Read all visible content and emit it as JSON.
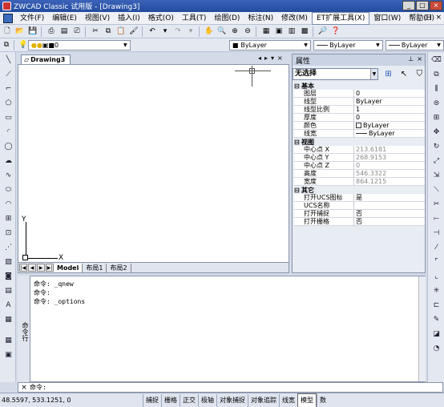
{
  "window": {
    "title": "ZWCAD Classic 试用版 - [Drawing3]"
  },
  "menu": [
    "文件(F)",
    "编辑(E)",
    "视图(V)",
    "插入(I)",
    "格式(O)",
    "工具(T)",
    "绘图(D)",
    "标注(N)",
    "修改(M)",
    "ET扩展工具(X)",
    "窗口(W)",
    "帮助(H)"
  ],
  "menu_active_index": 9,
  "toolbar2": {
    "layer_value": "0",
    "color_value": "ByLayer",
    "linetype_value": "ByLayer",
    "lineweight_value": "ByLayer"
  },
  "document": {
    "tab_label": "Drawing3",
    "axis_x": "X",
    "axis_y": "Y",
    "layout_tabs": [
      "Model",
      "布局1",
      "布局2"
    ]
  },
  "properties": {
    "header": "属性",
    "selection": "无选择",
    "categories": [
      {
        "name": "基本",
        "rows": [
          {
            "k": "图层",
            "v": "0",
            "dim": false
          },
          {
            "k": "线型",
            "v": "ByLayer",
            "dim": false
          },
          {
            "k": "线型比例",
            "v": "1",
            "dim": false
          },
          {
            "k": "厚度",
            "v": "0",
            "dim": false
          },
          {
            "k": "颜色",
            "v": "ByLayer",
            "dim": false,
            "marker": "swatch"
          },
          {
            "k": "线宽",
            "v": "ByLayer",
            "dim": false,
            "marker": "line"
          }
        ]
      },
      {
        "name": "视图",
        "rows": [
          {
            "k": "中心点 X",
            "v": "213.6181",
            "dim": true
          },
          {
            "k": "中心点 Y",
            "v": "268.9153",
            "dim": true
          },
          {
            "k": "中心点 Z",
            "v": "0",
            "dim": true
          },
          {
            "k": "高度",
            "v": "546.3322",
            "dim": true
          },
          {
            "k": "宽度",
            "v": "864.1215",
            "dim": true
          }
        ]
      },
      {
        "name": "其它",
        "rows": [
          {
            "k": "打开UCS图标",
            "v": "是",
            "dim": false
          },
          {
            "k": "UCS名称",
            "v": "",
            "dim": false
          },
          {
            "k": "打开捕捉",
            "v": "否",
            "dim": false
          },
          {
            "k": "打开栅格",
            "v": "否",
            "dim": false
          }
        ]
      }
    ]
  },
  "command": {
    "gutter": "命令行",
    "history": [
      "命令: _qnew",
      "命令:",
      "命令: _options"
    ],
    "prompt": "命令:"
  },
  "status": {
    "coords": "48.5597,  533.1251,  0",
    "buttons": [
      {
        "label": "捕捉",
        "pressed": false
      },
      {
        "label": "栅格",
        "pressed": false
      },
      {
        "label": "正交",
        "pressed": false
      },
      {
        "label": "极轴",
        "pressed": false
      },
      {
        "label": "对象捕捉",
        "pressed": false
      },
      {
        "label": "对象追踪",
        "pressed": false
      },
      {
        "label": "线宽",
        "pressed": false
      },
      {
        "label": "模型",
        "pressed": true
      },
      {
        "label": "数",
        "pressed": false
      }
    ]
  }
}
